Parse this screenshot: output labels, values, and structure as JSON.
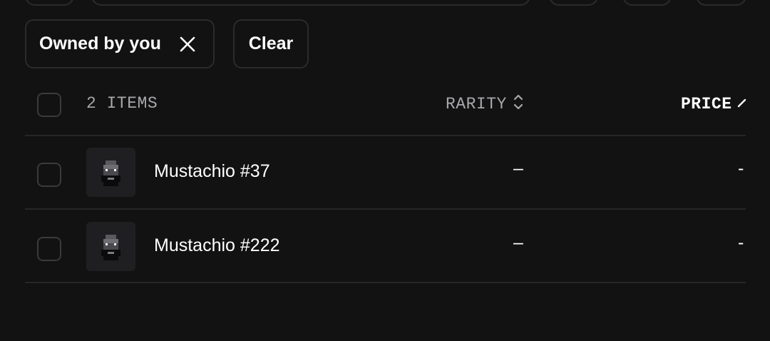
{
  "filters": {
    "active_chip_label": "Owned by you",
    "clear_label": "Clear"
  },
  "table": {
    "item_count_label": "2 ITEMS",
    "rarity_header": "RARITY",
    "price_header": "PRICE",
    "rows": [
      {
        "name": "Mustachio #37",
        "rarity": "–",
        "price": "-",
        "icon": "mustachio-avatar"
      },
      {
        "name": "Mustachio #222",
        "rarity": "–",
        "price": "-",
        "icon": "mustachio-avatar"
      }
    ]
  },
  "icons": {
    "chip_close": "close-icon",
    "sort_rarity": "sort-updown-icon",
    "sort_price": "sort-arrow-icon"
  }
}
